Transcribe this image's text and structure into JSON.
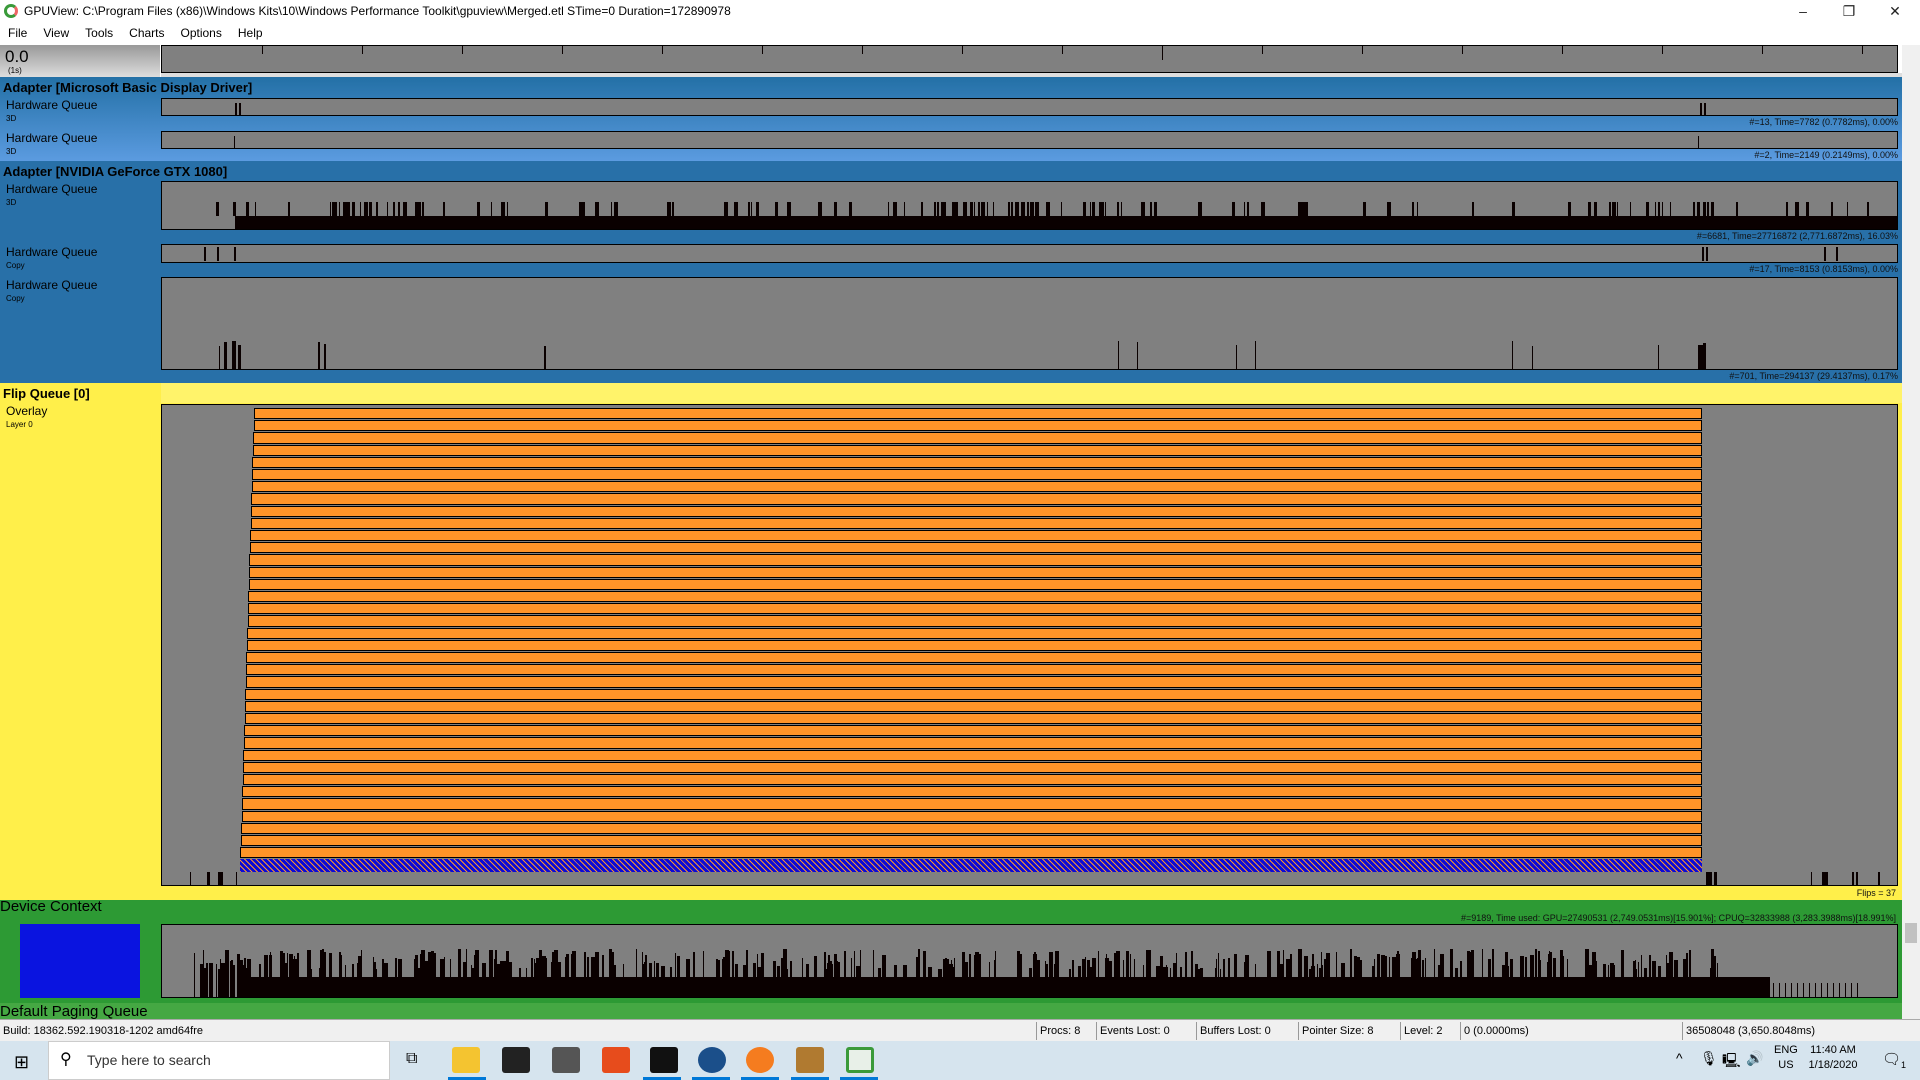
{
  "window": {
    "title": "GPUView: C:\\Program Files (x86)\\Windows Kits\\10\\Windows Performance Toolkit\\gpuview\\Merged.etl STime=0 Duration=172890978",
    "controls": [
      "–",
      "❐",
      "✕"
    ]
  },
  "menu": [
    "File",
    "View",
    "Tools",
    "Charts",
    "Options",
    "Help"
  ],
  "ruler": {
    "time": "0.0",
    "unit": "(1s)"
  },
  "adapters": [
    {
      "name": "Adapter [Microsoft Basic Display Driver]",
      "queues": [
        {
          "label": "Hardware Queue",
          "sub": "3D",
          "stats": "#=13,  Time=7782 (0.7782ms),  0.00%"
        },
        {
          "label": "Hardware Queue",
          "sub": "3D",
          "stats": "#=2,  Time=2149 (0.2149ms),  0.00%"
        }
      ]
    },
    {
      "name": "Adapter [NVIDIA GeForce GTX 1080]",
      "queues": [
        {
          "label": "Hardware Queue",
          "sub": "3D",
          "stats": "#=6681,  Time=27716872 (2,771.6872ms),  16.03%"
        },
        {
          "label": "Hardware Queue",
          "sub": "Copy",
          "stats": "#=17,  Time=8153 (0.8153ms),  0.00%"
        },
        {
          "label": "Hardware Queue",
          "sub": "Copy",
          "stats": "#=701,  Time=294137 (29.4137ms),  0.17%"
        }
      ]
    }
  ],
  "flip_queue": {
    "name": "Flip Queue [0]",
    "label": "Overlay",
    "sub": "Layer 0",
    "stats": "Flips = 37",
    "colors": {
      "bg": "#ffef4a",
      "bar": "#ff9428",
      "hatch": "#0a0ad8"
    }
  },
  "device_context": {
    "name": "Device Context",
    "stats": "#=9189, Time used: GPU=27490531 (2,749.0531ms)[15.901%]; CPUQ=32833988 (3,283.3988ms)[18.991%]",
    "color": "#0a14e0"
  },
  "paging": {
    "name": "Default Paging Queue"
  },
  "status": {
    "build": "Build: 18362.592.190318-1202  amd64fre",
    "procs": "Procs: 8",
    "events_lost": "Events Lost: 0",
    "buffers_lost": "Buffers Lost: 0",
    "pointer_size": "Pointer Size: 8",
    "level": "Level: 2",
    "cursor": "0 (0.0000ms)",
    "range": "36508048 (3,650.8048ms)"
  },
  "taskbar": {
    "search_placeholder": "Type here to search",
    "lang": "ENG",
    "region": "US",
    "time": "11:40 AM",
    "date": "1/18/2020",
    "notifications": "1"
  }
}
